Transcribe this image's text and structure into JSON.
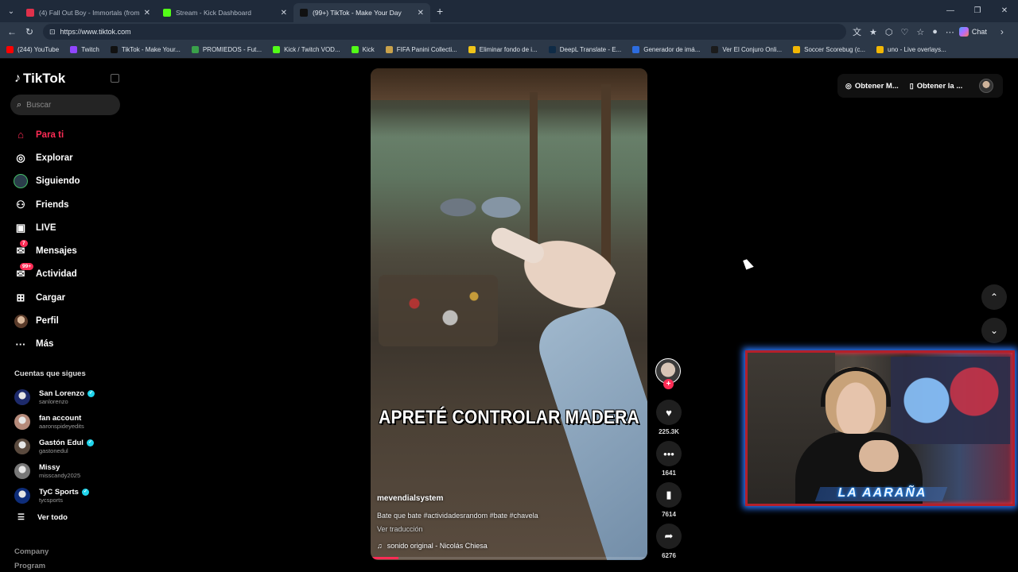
{
  "browser": {
    "tabs": [
      {
        "title": "(4) Fall Out Boy - Immortals (from",
        "icon_color": "#e0314b",
        "active": false
      },
      {
        "title": "Stream - Kick Dashboard",
        "icon_color": "#53fc18",
        "active": false
      },
      {
        "title": "(99+) TikTok - Make Your Day",
        "icon_color": "#111111",
        "active": true
      }
    ],
    "url": "https://www.tiktok.com",
    "chat_label": "Chat",
    "bookmarks": [
      {
        "label": "(244) YouTube",
        "icon_color": "#ff0000"
      },
      {
        "label": "Twitch",
        "icon_color": "#9146ff"
      },
      {
        "label": "TikTok - Make Your...",
        "icon_color": "#111111"
      },
      {
        "label": "PROMIEDOS - Fut...",
        "icon_color": "#3aa14a"
      },
      {
        "label": "Kick / Twitch VOD...",
        "icon_color": "#53fc18"
      },
      {
        "label": "Kick",
        "icon_color": "#53fc18"
      },
      {
        "label": "FIFA Panini Collecti...",
        "icon_color": "#c9a24b"
      },
      {
        "label": "Eliminar fondo de i...",
        "icon_color": "#f0c419"
      },
      {
        "label": "DeepL Translate - E...",
        "icon_color": "#0f2b46"
      },
      {
        "label": "Generador de imá...",
        "icon_color": "#2d6cdf"
      },
      {
        "label": "Ver El Conjuro Onli...",
        "icon_color": "#1b1b1b"
      },
      {
        "label": "Soccer Scorebug (c...",
        "icon_color": "#f2b705"
      },
      {
        "label": "uno - Live overlays...",
        "icon_color": "#f2b705"
      }
    ]
  },
  "tiktok": {
    "logo": "TikTok",
    "search_placeholder": "Buscar",
    "nav": [
      {
        "label": "Para ti",
        "icon": "home-icon",
        "active": true
      },
      {
        "label": "Explorar",
        "icon": "compass-icon"
      },
      {
        "label": "Siguiendo",
        "icon": "following-avatar-icon"
      },
      {
        "label": "Friends",
        "icon": "friends-icon"
      },
      {
        "label": "LIVE",
        "icon": "live-icon"
      },
      {
        "label": "Mensajes",
        "icon": "messages-icon",
        "badge": "7"
      },
      {
        "label": "Actividad",
        "icon": "activity-icon",
        "badge": "99+"
      },
      {
        "label": "Cargar",
        "icon": "upload-icon"
      },
      {
        "label": "Perfil",
        "icon": "profile-avatar-icon"
      },
      {
        "label": "Más",
        "icon": "more-icon"
      }
    ],
    "following_title": "Cuentas que sigues",
    "following": [
      {
        "name": "San Lorenzo",
        "handle": "sanlorenzo",
        "verified": true,
        "color": "#1d2a6b"
      },
      {
        "name": "fan account",
        "handle": "aaronspideyedits",
        "verified": false,
        "color": "#b58a7a"
      },
      {
        "name": "Gastón Edul",
        "handle": "gastonedul",
        "verified": true,
        "color": "#5a4a3e"
      },
      {
        "name": "Missy",
        "handle": "misscandy2025",
        "verified": false,
        "color": "#777777"
      },
      {
        "name": "TyC Sports",
        "handle": "tycsports",
        "verified": true,
        "color": "#0e2d7a"
      }
    ],
    "see_all": "Ver todo",
    "footer_company": "Company",
    "footer_program": "Program",
    "top_right": {
      "get_app_1": "Obtener M...",
      "get_app_2": "Obtener la ..."
    },
    "video": {
      "caption": "APRETÉ CONTROLAR MADERA",
      "author": "mevendialsystem",
      "description": "Bate que bate #actividadesrandom #bate #chavela",
      "translate": "Ver traducción",
      "sound": "sonido original - Nicolás Chiesa",
      "progress": 0.1
    },
    "actions": {
      "likes": "225.3K",
      "comments": "1641",
      "saves": "7614",
      "shares": "6276"
    }
  },
  "webcam": {
    "label": "LA  AARAÑA"
  }
}
